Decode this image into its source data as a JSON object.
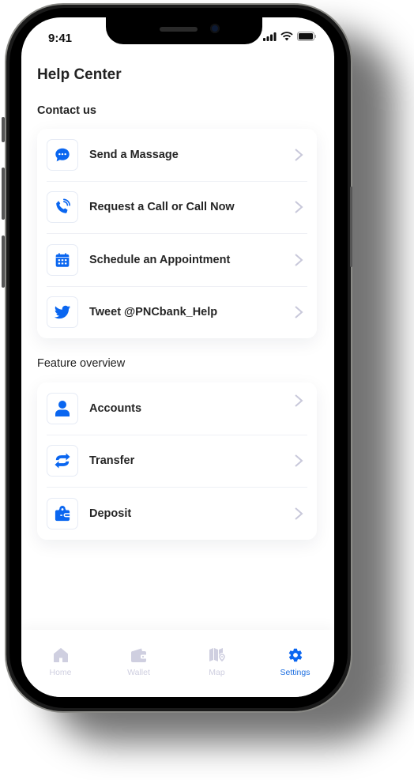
{
  "status_bar": {
    "time": "9:41"
  },
  "header": {
    "title": "Help Center"
  },
  "colors": {
    "accent": "#0a66f0",
    "inactive": "#cfcfe0",
    "chevron": "#c8c8da"
  },
  "sections": [
    {
      "title": "Contact us",
      "items": [
        {
          "label": "Send a Massage",
          "icon": "chat-bubble-icon"
        },
        {
          "label": "Request a Call or Call Now",
          "icon": "phone-call-icon"
        },
        {
          "label": "Schedule an Appointment",
          "icon": "calendar-icon"
        },
        {
          "label": "Tweet @PNCbank_Help",
          "icon": "twitter-icon"
        }
      ]
    },
    {
      "title": "Feature overview",
      "items": [
        {
          "label": "Accounts",
          "icon": "user-icon"
        },
        {
          "label": "Transfer",
          "icon": "transfer-icon"
        },
        {
          "label": "Deposit",
          "icon": "deposit-wallet-icon"
        }
      ]
    }
  ],
  "tabbar": {
    "items": [
      {
        "label": "Home",
        "icon": "home-icon",
        "active": false
      },
      {
        "label": "Wallet",
        "icon": "wallet-icon",
        "active": false
      },
      {
        "label": "Map",
        "icon": "map-icon",
        "active": false
      },
      {
        "label": "Settings",
        "icon": "gear-icon",
        "active": true
      }
    ]
  }
}
